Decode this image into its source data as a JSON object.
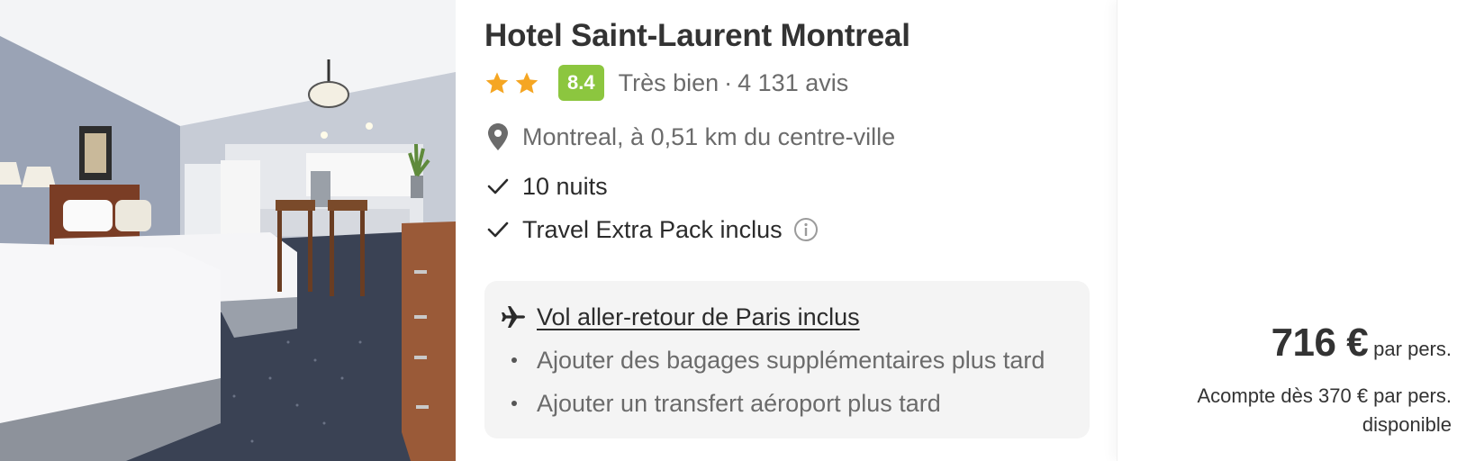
{
  "hotel": {
    "photo_alt": "Chambre d'hôtel",
    "name": "Hotel Saint-Laurent Montreal",
    "stars": 2,
    "score": "8.4",
    "score_label": "Très bien",
    "separator": "·",
    "review_count": "4 131 avis",
    "location": "Montreal, à 0,51 km du centre-ville",
    "features": [
      {
        "label": "10 nuits",
        "icon": "check-icon"
      },
      {
        "label": "Travel Extra Pack inclus",
        "icon": "check-icon",
        "info_icon": "info-icon"
      }
    ]
  },
  "flight": {
    "icon": "plane-icon",
    "link_label": "Vol aller-retour de Paris inclus",
    "items": [
      "Ajouter des bagages supplémentaires plus tard",
      "Ajouter un transfert aéroport plus tard"
    ]
  },
  "price": {
    "amount": "716 €",
    "unit": "par pers.",
    "deposit_line1": "Acompte dès 370 € par pers.",
    "deposit_line2": "disponible"
  },
  "colors": {
    "star": "#f5a623",
    "score_badge": "#8cc63f",
    "box_bg": "#f4f4f4"
  }
}
